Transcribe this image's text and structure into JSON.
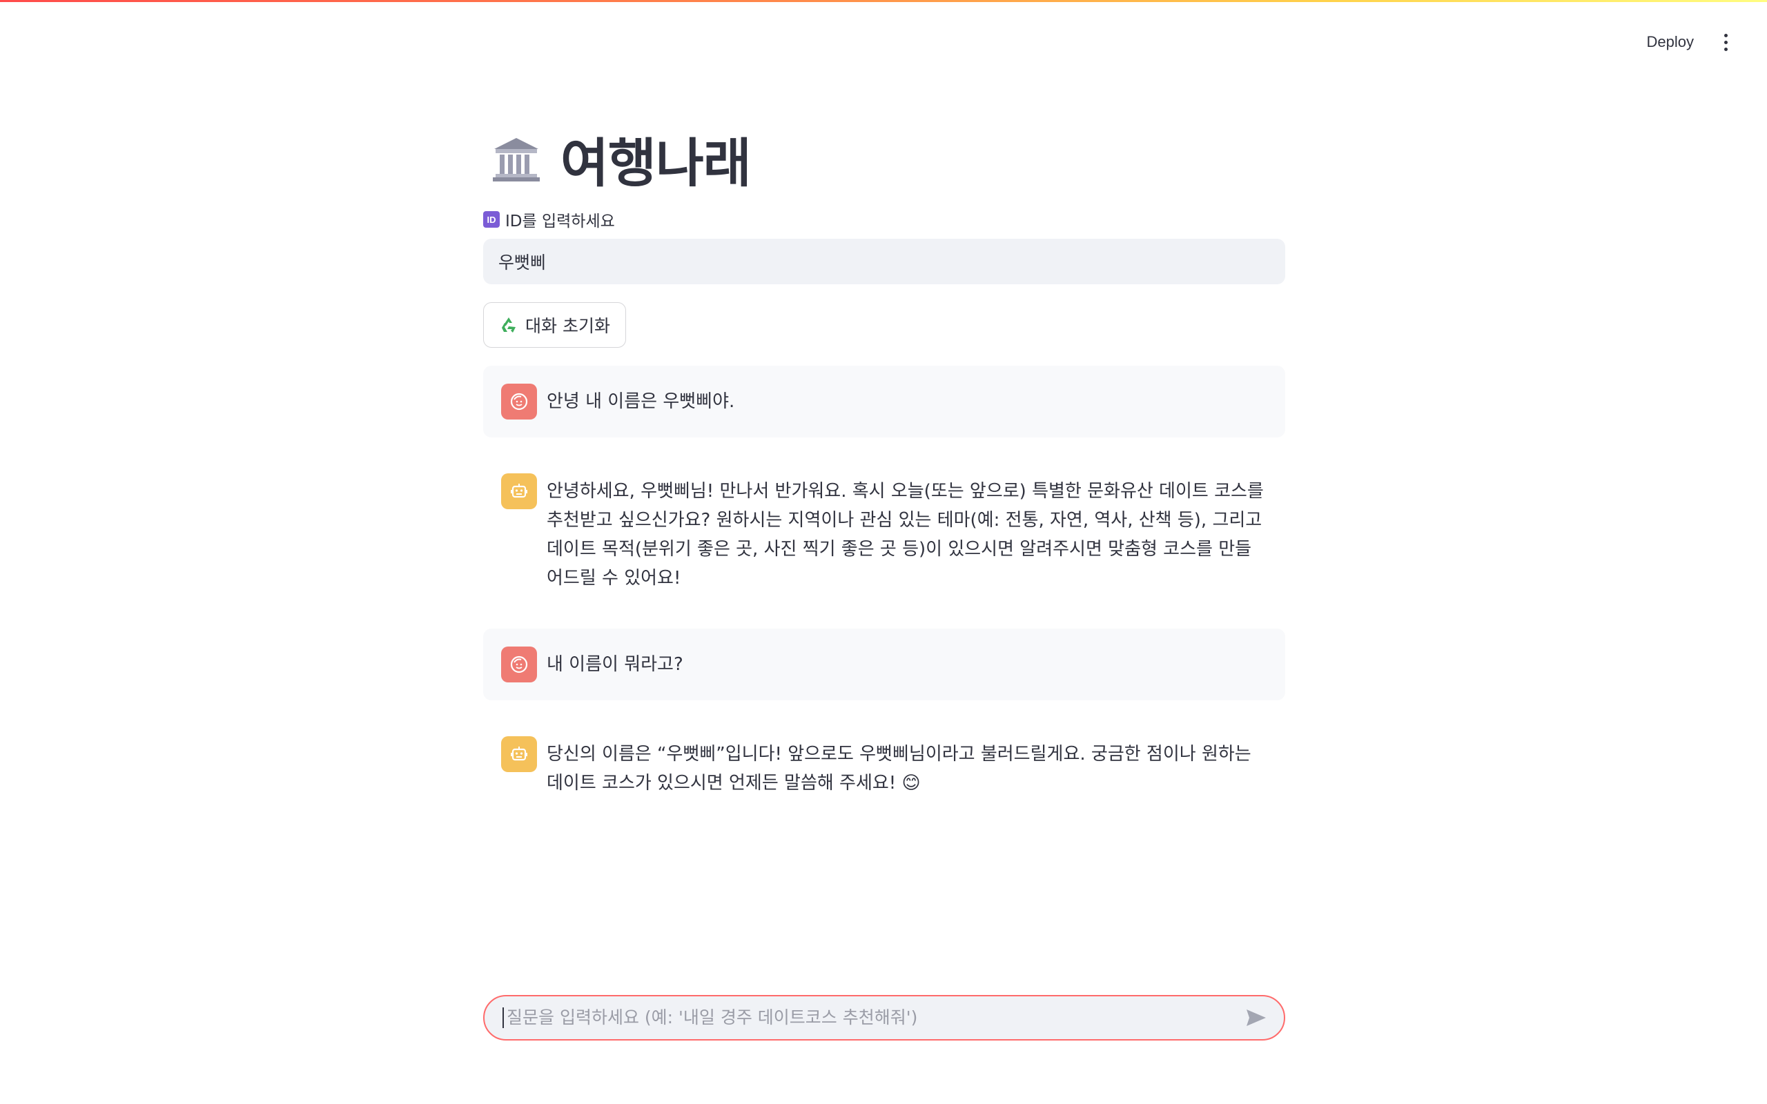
{
  "header": {
    "deploy_label": "Deploy",
    "menu_icon": "more-vertical-icon"
  },
  "page": {
    "title": "여행나래",
    "title_icon": "classical-building-icon"
  },
  "id_field": {
    "badge": "ID",
    "label": "ID를 입력하세요",
    "value": "우뻣삐"
  },
  "reset_button": {
    "icon": "recycle-icon",
    "label": "대화 초기화"
  },
  "messages": [
    {
      "role": "user",
      "text": "안녕 내 이름은 우뻣삐야."
    },
    {
      "role": "assistant",
      "text": "안녕하세요, 우뻣삐님! 만나서 반가워요. 혹시 오늘(또는 앞으로) 특별한 문화유산 데이트 코스를 추천받고 싶으신가요? 원하시는 지역이나 관심 있는 테마(예: 전통, 자연, 역사, 산책 등), 그리고 데이트 목적(분위기 좋은 곳, 사진 찍기 좋은 곳 등)이 있으시면 알려주시면 맞춤형 코스를 만들어드릴 수 있어요!"
    },
    {
      "role": "user",
      "text": "내 이름이 뭐라고?"
    },
    {
      "role": "assistant",
      "text": "당신의 이름은 “우뻣삐”입니다! 앞으로도 우뻣삐님이라고 불러드릴게요. 궁금한 점이나 원하는 데이트 코스가 있으시면 언제든 말씀해 주세요! 😊"
    }
  ],
  "chat_input": {
    "placeholder": "질문을 입력하세요 (예: '내일 경주 데이트코스 추천해줘')",
    "send_icon": "send-icon"
  },
  "colors": {
    "user_avatar": "#ef7b73",
    "assistant_avatar": "#f5c15a",
    "input_border": "#ff6b6b",
    "id_badge": "#7b5cd6"
  }
}
